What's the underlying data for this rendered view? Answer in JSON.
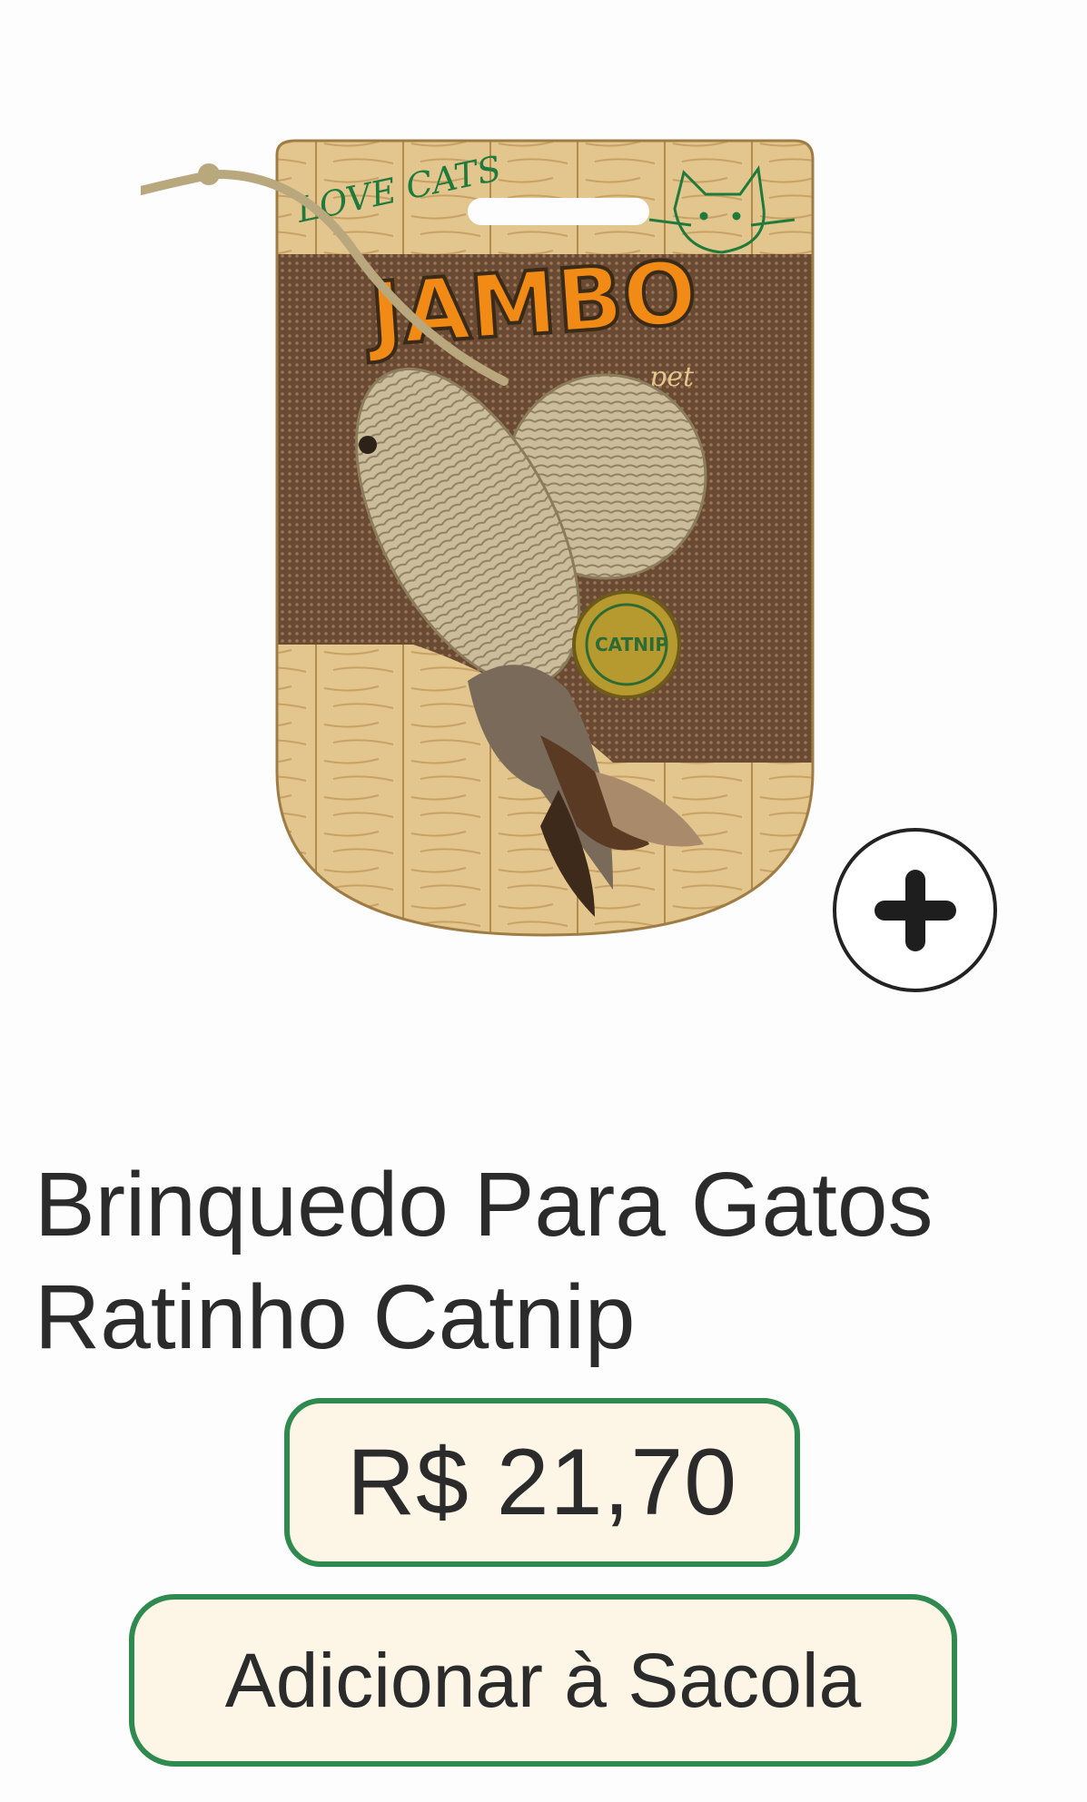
{
  "product": {
    "image": {
      "brand_text": "JAMBO",
      "brand_sub": "pet",
      "tagline": "LOVE CATS",
      "seal_text": "CATNIP"
    },
    "title": "Brinquedo Para Gatos Ratinho Catnip",
    "price": "R$ 21,70",
    "zoom_icon": "plus-circle-icon"
  },
  "actions": {
    "add_to_bag_label": "Adicionar à Sacola"
  },
  "colors": {
    "accent_border": "#2e8a4e",
    "button_fill": "#fdf5e6",
    "text": "#2b2b2b"
  }
}
